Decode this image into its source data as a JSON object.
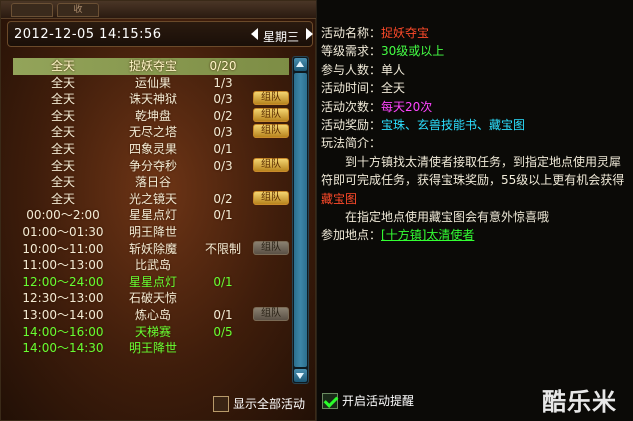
{
  "header": {
    "tabs": [
      "",
      "收"
    ],
    "date": "2012-12-05 14:15:56",
    "weekday": "星期三"
  },
  "activities": [
    {
      "time": "全天",
      "name": "捉妖夺宝",
      "count": "0/20",
      "team": false,
      "style": "sel"
    },
    {
      "time": "全天",
      "name": "运仙果",
      "count": "1/3",
      "team": false,
      "style": ""
    },
    {
      "time": "全天",
      "name": "诛天神狱",
      "count": "0/3",
      "team": true,
      "team_label": "组队",
      "style": ""
    },
    {
      "time": "全天",
      "name": "乾坤盘",
      "count": "0/2",
      "team": true,
      "team_label": "组队",
      "style": ""
    },
    {
      "time": "全天",
      "name": "无尽之塔",
      "count": "0/3",
      "team": true,
      "team_label": "组队",
      "style": ""
    },
    {
      "time": "全天",
      "name": "四象灵果",
      "count": "0/1",
      "team": false,
      "style": ""
    },
    {
      "time": "全天",
      "name": "争分夺秒",
      "count": "0/3",
      "team": true,
      "team_label": "组队",
      "style": ""
    },
    {
      "time": "全天",
      "name": "落日谷",
      "count": "",
      "team": false,
      "style": ""
    },
    {
      "time": "全天",
      "name": "光之镜天",
      "count": "0/2",
      "team": true,
      "team_label": "组队",
      "style": ""
    },
    {
      "time": "00:00～2:00",
      "name": "星星点灯",
      "count": "0/1",
      "team": false,
      "style": ""
    },
    {
      "time": "01:00～01:30",
      "name": "明王降世",
      "count": "",
      "team": false,
      "style": ""
    },
    {
      "time": "10:00～11:00",
      "name": "斩妖除魔",
      "count": "不限制",
      "team": true,
      "team_label": "组队",
      "dim": true,
      "style": ""
    },
    {
      "time": "11:00～13:00",
      "name": "比武岛",
      "count": "",
      "team": false,
      "style": ""
    },
    {
      "time": "12:00～24:00",
      "name": "星星点灯",
      "count": "0/1",
      "team": false,
      "style": "green"
    },
    {
      "time": "12:30～13:00",
      "name": "石破天惊",
      "count": "",
      "team": false,
      "style": ""
    },
    {
      "time": "13:00～14:00",
      "name": "炼心岛",
      "count": "0/1",
      "team": true,
      "team_label": "组队",
      "dim": true,
      "style": ""
    },
    {
      "time": "14:00～16:00",
      "name": "天梯赛",
      "count": "0/5",
      "team": false,
      "style": "green"
    },
    {
      "time": "14:00～14:30",
      "name": "明王降世",
      "count": "",
      "team": false,
      "style": "green"
    }
  ],
  "show_all_label": "显示全部活动",
  "detail": {
    "name_label": "活动名称：",
    "name": "捉妖夺宝",
    "level_label": "等级需求：",
    "level": "30级或以上",
    "people_label": "参与人数：",
    "people": "单人",
    "time_label": "活动时间：",
    "time": "全天",
    "times_label": "活动次数：",
    "times": "每天20次",
    "reward_label": "活动奖励：",
    "reward": "宝珠、玄兽技能书、藏宝图",
    "intro_label": "玩法简介：",
    "intro_1a": "到十方镇找太清使者接取任务，到指定地点使用灵犀符即可完成任务，获得宝珠奖励，55级以上更有机会获得",
    "intro_1b": "藏宝图",
    "intro_2": "在指定地点使用藏宝图会有意外惊喜哦",
    "place_label": "参加地点：",
    "place": "[十方镇]太清使者"
  },
  "remind_label": "开启活动提醒",
  "logo": "酷乐米",
  "colors": {
    "selected_row": "#93a45a",
    "highlight_red": "#ff4a2a",
    "green_text": "#44ff44",
    "cyan_text": "#2ce0ff",
    "pink_text": "#ff44ff"
  }
}
